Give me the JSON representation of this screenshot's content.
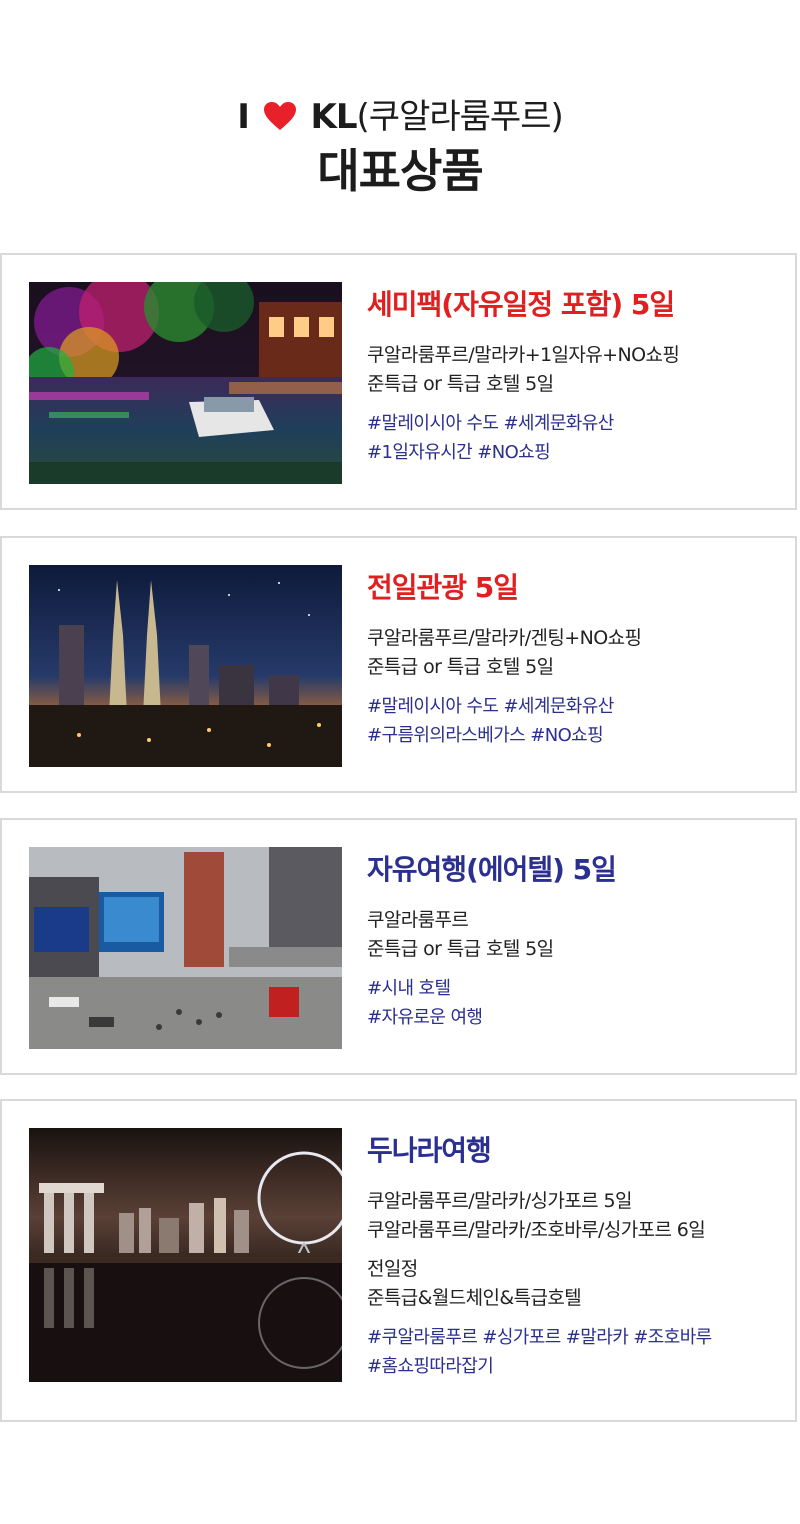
{
  "header": {
    "i": "I",
    "kl": "KL",
    "korean_name": "(쿠알라룸푸르)",
    "subtitle": "대표상품"
  },
  "products": [
    {
      "name": "세미팩(자유일정 포함) 5일",
      "name_color": "#e02020",
      "route": "쿠알라룸푸르/말라카+1일자유+NO쇼핑",
      "hotel": "준특급 or 특급 호텔 5일",
      "tags1": "#말레이시아 수도 #세계문화유산",
      "tags2": "#1일자유시간 #NO쇼핑"
    },
    {
      "name": "전일관광 5일",
      "name_color": "#e02020",
      "route": "쿠알라룸푸르/말라카/겐팅+NO쇼핑",
      "hotel": "준특급 or 특급 호텔 5일",
      "tags1": "#말레이시아 수도 #세계문화유산",
      "tags2": "#구름위의라스베가스 #NO쇼핑"
    },
    {
      "name": "자유여행(에어텔) 5일",
      "name_color": "#2b2f8f",
      "route": "쿠알라룸푸르",
      "hotel": "준특급 or 특급 호텔 5일",
      "tags1": "#시내 호텔",
      "tags2": "#자유로운 여행"
    },
    {
      "name": "두나라여행",
      "name_color": "#2b2f8f",
      "route": "쿠알라룸푸르/말라카/싱가포르 5일",
      "route2": "쿠알라룸푸르/말라카/조호바루/싱가포르 6일",
      "itinerary": "전일정",
      "hotel": "준특급&월드체인&특급호텔",
      "tags1": "#쿠알라룸푸르 #싱가포르 #말라카 #조호바루",
      "tags2": "#홈쇼핑따라잡기"
    }
  ]
}
